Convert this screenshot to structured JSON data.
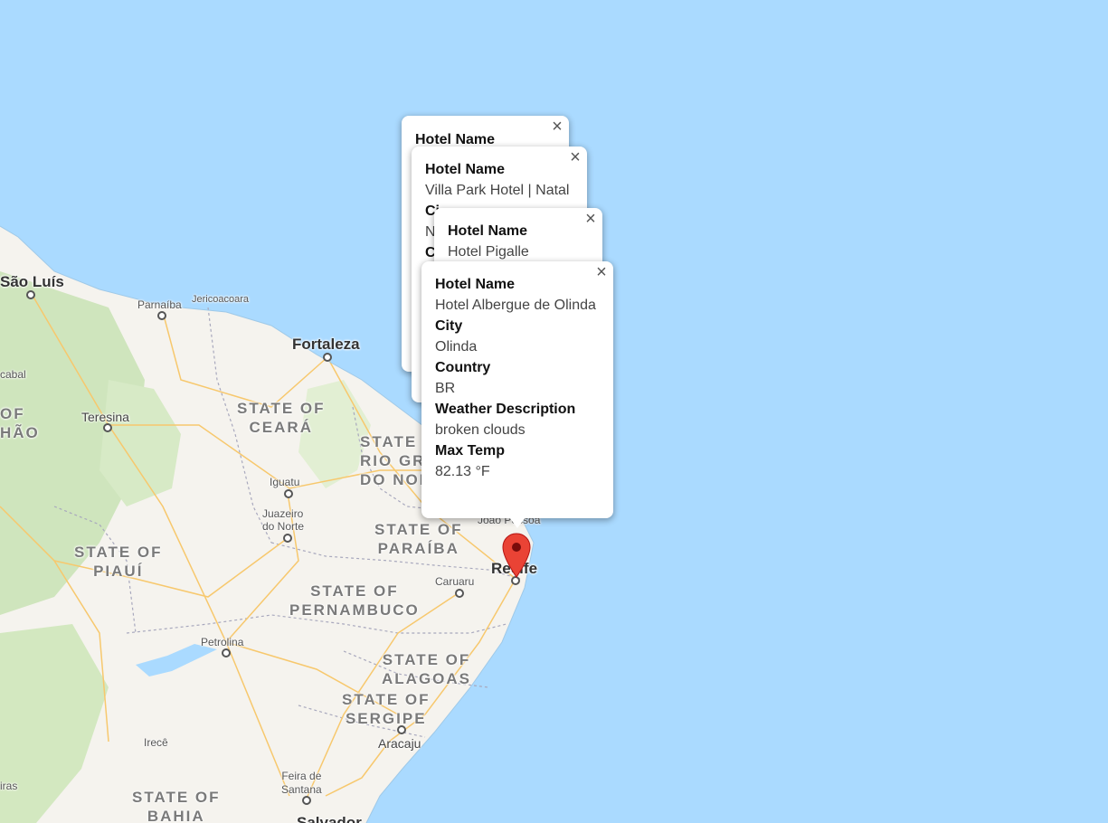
{
  "map": {
    "colors": {
      "water": "#aadaff",
      "land": "#f5f3ee",
      "green": "#cde4b8",
      "road": "#f7c86d",
      "pin": "#ea4335"
    },
    "labels": {
      "sao_luis": "São Luís",
      "parnaiba": "Parnaíba",
      "jericoacoara": "Jericoacoara",
      "fortaleza": "Fortaleza",
      "cabal": "cabal",
      "of_hao": "OF\nHÃO",
      "teresina": "Teresina",
      "state_ceara": "STATE OF\nCEARÁ",
      "state_rio_grande": "STATE\nRIO GRA\nDO NOR",
      "iguatu": "Iguatu",
      "juazeiro": "Juazeiro\ndo Norte",
      "state_paraiba": "STATE OF\nPARAÍBA",
      "joao_pessoa": "João Pessoa",
      "state_piaui": "STATE OF\nPIAUÍ",
      "recife": "Recife",
      "caruaru": "Caruaru",
      "state_pernambuco": "STATE OF\nPERNAMBUCO",
      "petrolina": "Petrolina",
      "state_alagoas": "STATE OF\nALAGOAS",
      "state_sergipe": "STATE OF\nSERGIPE",
      "iguatu_small": "Irecê",
      "aracaju": "Aracaju",
      "feira": "Feira de\nSantana",
      "state_bahia": "STATE OF\nBAHIA",
      "iras": "iras",
      "salvador": "Salvador"
    }
  },
  "infowindows": [
    {
      "fields": [
        {
          "label": "Hotel Name",
          "value": ""
        }
      ]
    },
    {
      "fields": [
        {
          "label": "Hotel Name",
          "value": "Villa Park Hotel | Natal"
        },
        {
          "label": "Ci",
          "value": "N"
        },
        {
          "label": "C",
          "value": ""
        }
      ]
    },
    {
      "fields": [
        {
          "label": "Hotel Name",
          "value": "Hotel Pigalle"
        }
      ]
    },
    {
      "fields": [
        {
          "label": "Hotel Name",
          "value": "Hotel Albergue de Olinda"
        },
        {
          "label": "City",
          "value": "Olinda"
        },
        {
          "label": "Country",
          "value": "BR"
        },
        {
          "label": "Weather Description",
          "value": "broken clouds"
        },
        {
          "label": "Max Temp",
          "value": "82.13 °F"
        }
      ]
    }
  ],
  "close_glyph": "×"
}
